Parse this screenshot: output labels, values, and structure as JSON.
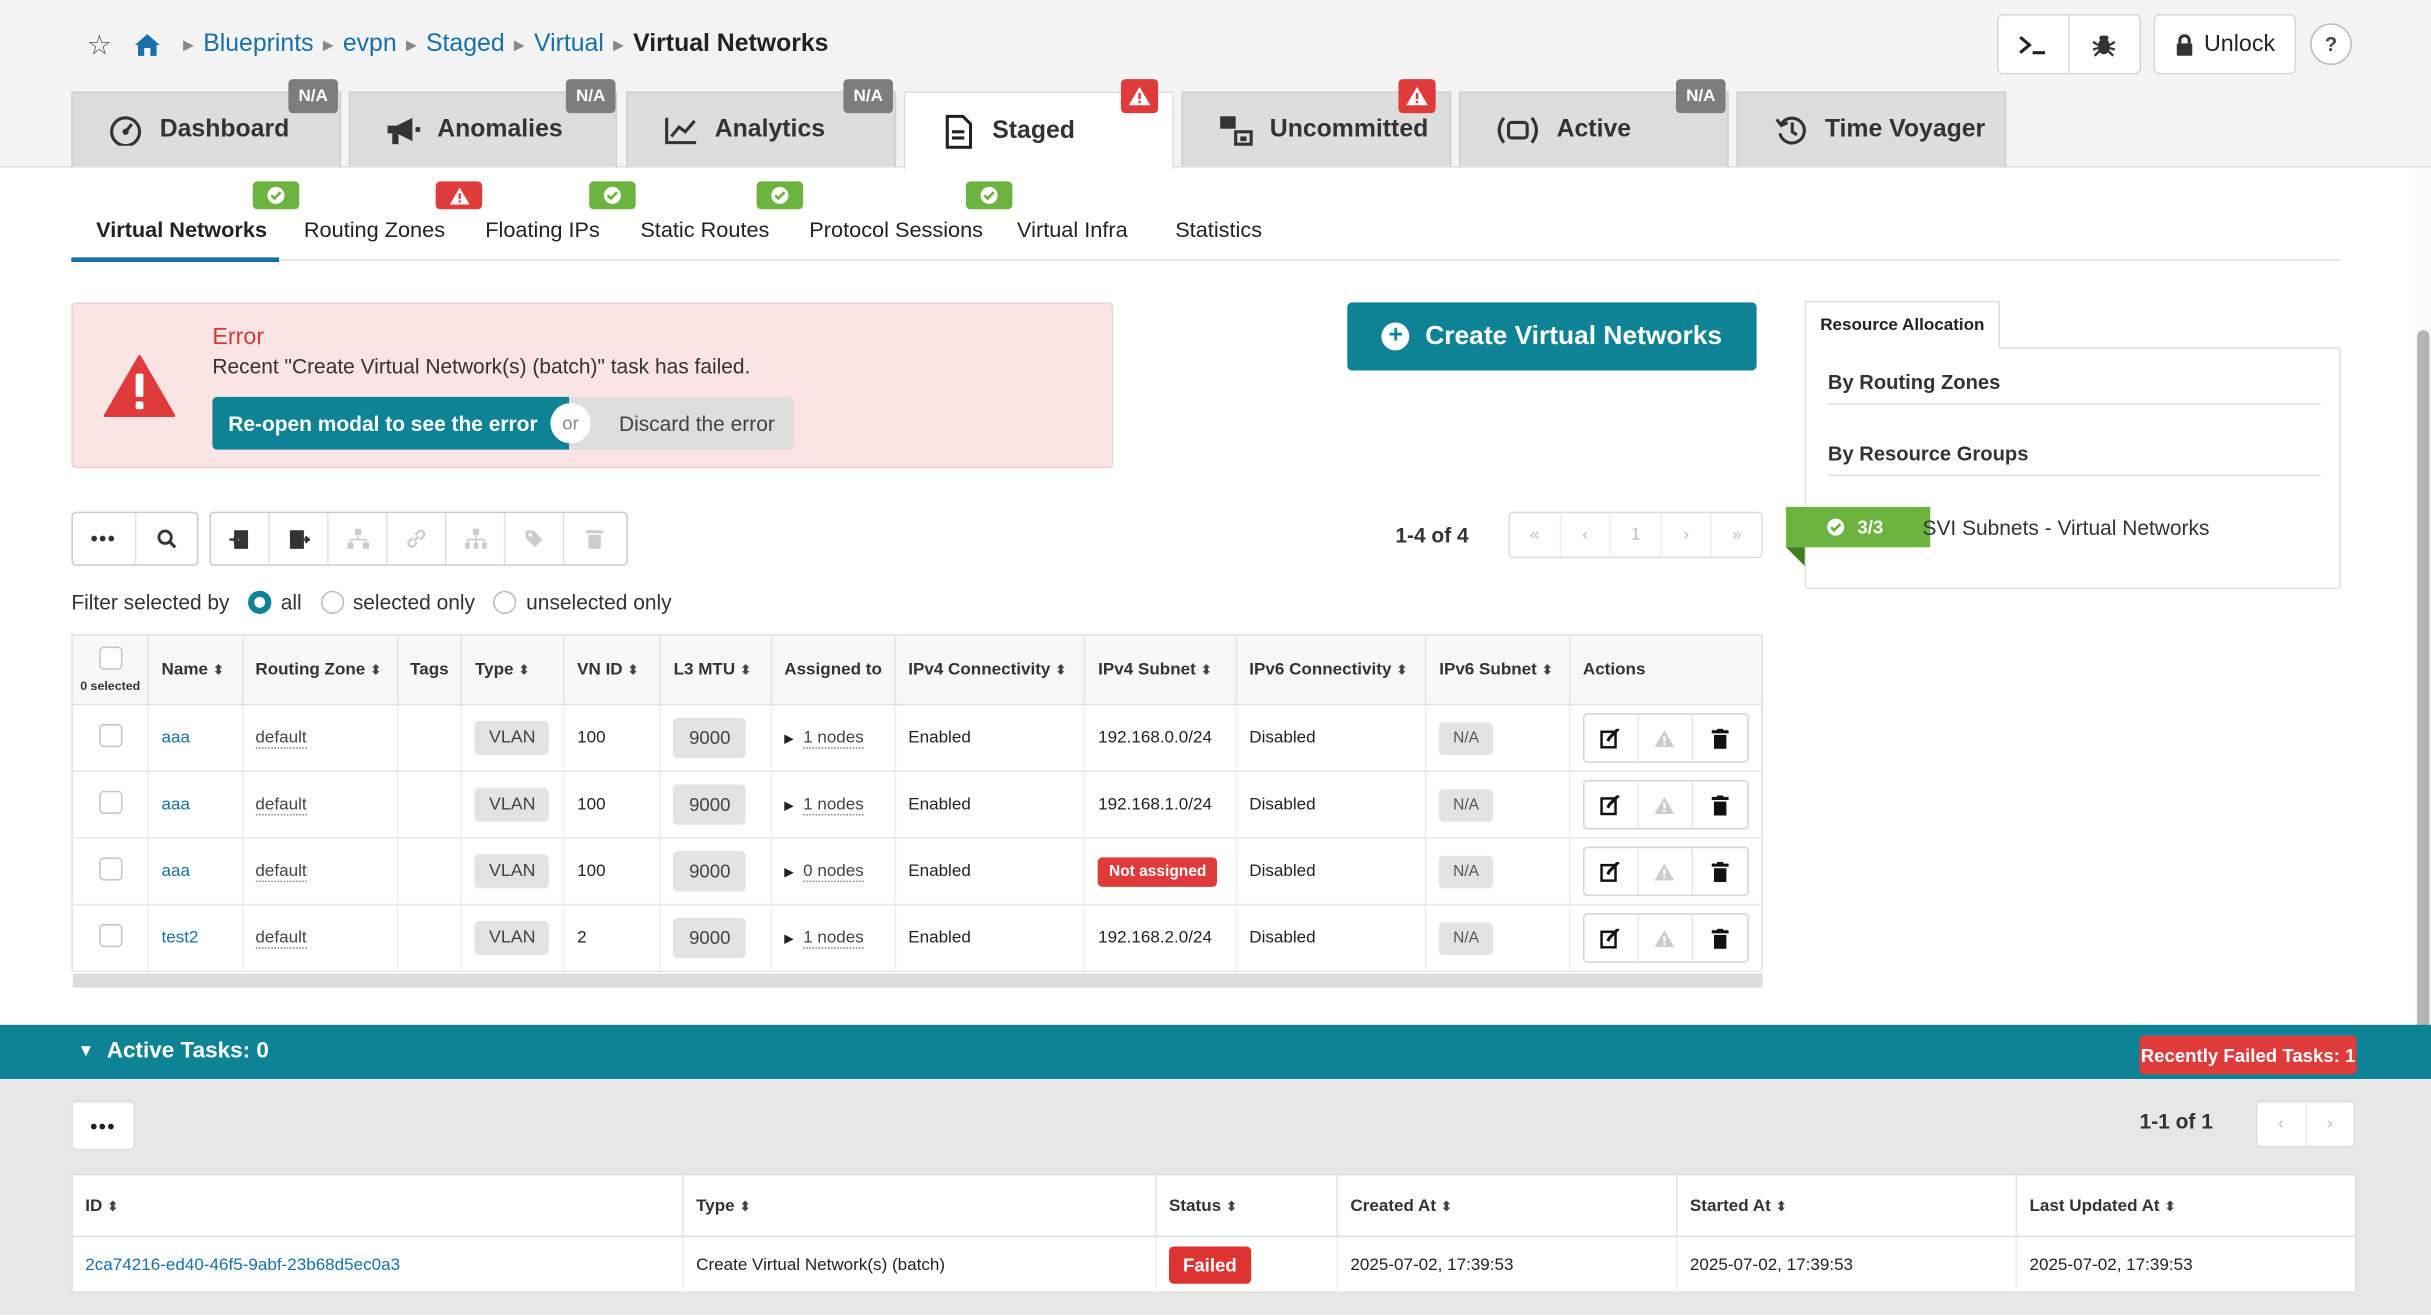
{
  "breadcrumbs": [
    "Blueprints",
    "evpn",
    "Staged",
    "Virtual",
    "Virtual Networks"
  ],
  "toolbar": {
    "unlock_label": "Unlock",
    "help_label": "?"
  },
  "main_tabs": [
    {
      "label": "Dashboard",
      "badge": "N/A"
    },
    {
      "label": "Anomalies",
      "badge": "N/A"
    },
    {
      "label": "Analytics",
      "badge": "N/A"
    },
    {
      "label": "Staged",
      "badge": "warning"
    },
    {
      "label": "Uncommitted",
      "badge": "warning"
    },
    {
      "label": "Active",
      "badge": "N/A"
    },
    {
      "label": "Time Voyager",
      "badge": ""
    }
  ],
  "sub_tabs": [
    "Virtual Networks",
    "Routing Zones",
    "Floating IPs",
    "Static Routes",
    "Protocol Sessions",
    "Virtual Infra",
    "Statistics"
  ],
  "error": {
    "title": "Error",
    "message": "Recent \"Create Virtual Network(s) (batch)\" task has failed.",
    "reopen_label": "Re-open modal to see the error",
    "or_label": "or",
    "discard_label": "Discard the error"
  },
  "create_label": "Create Virtual Networks",
  "resource_allocation": {
    "tab_label": "Resource Allocation",
    "by_routing_zones": "By Routing Zones",
    "by_resource_groups": "By Resource Groups",
    "svi_badge": "3/3",
    "svi_label": "SVI Subnets - Virtual Networks"
  },
  "pagination": {
    "count": "1-4 of 4",
    "page": "1"
  },
  "filter": {
    "label": "Filter selected by",
    "all": "all",
    "selected": "selected only",
    "unselected": "unselected only"
  },
  "table": {
    "selected_label": "0 selected",
    "headers": [
      "Name",
      "Routing Zone",
      "Tags",
      "Type",
      "VN ID",
      "L3 MTU",
      "Assigned to",
      "IPv4 Connectivity",
      "IPv4 Subnet",
      "IPv6 Connectivity",
      "IPv6 Subnet",
      "Actions"
    ],
    "rows": [
      {
        "name": "aaa",
        "zone": "default",
        "type": "VLAN",
        "vnid": "100",
        "mtu": "9000",
        "assigned": "1 nodes",
        "ipv4conn": "Enabled",
        "ipv4subnet": "192.168.0.0/24",
        "ipv6conn": "Disabled",
        "ipv6subnet": "N/A"
      },
      {
        "name": "aaa",
        "zone": "default",
        "type": "VLAN",
        "vnid": "100",
        "mtu": "9000",
        "assigned": "1 nodes",
        "ipv4conn": "Enabled",
        "ipv4subnet": "192.168.1.0/24",
        "ipv6conn": "Disabled",
        "ipv6subnet": "N/A"
      },
      {
        "name": "aaa",
        "zone": "default",
        "type": "VLAN",
        "vnid": "100",
        "mtu": "9000",
        "assigned": "0 nodes",
        "ipv4conn": "Enabled",
        "ipv4subnet": "Not assigned",
        "ipv6conn": "Disabled",
        "ipv6subnet": "N/A"
      },
      {
        "name": "test2",
        "zone": "default",
        "type": "VLAN",
        "vnid": "2",
        "mtu": "9000",
        "assigned": "1 nodes",
        "ipv4conn": "Enabled",
        "ipv4subnet": "192.168.2.0/24",
        "ipv6conn": "Disabled",
        "ipv6subnet": "N/A"
      }
    ]
  },
  "tasks": {
    "title": "Active Tasks: 0",
    "failed_label": "Recently Failed Tasks: 1",
    "count": "1-1 of 1",
    "headers": [
      "ID",
      "Type",
      "Status",
      "Created At",
      "Started At",
      "Last Updated At"
    ],
    "rows": [
      {
        "id": "2ca74216-ed40-46f5-9abf-23b68d5ec0a3",
        "type": "Create Virtual Network(s) (batch)",
        "status": "Failed",
        "created": "2025-07-02, 17:39:53",
        "started": "2025-07-02, 17:39:53",
        "updated": "2025-07-02, 17:39:53"
      }
    ]
  },
  "colors": {
    "accent": "#0e8396",
    "link": "#1770a6",
    "error": "#e03b3b",
    "ok": "#6cb33f"
  }
}
